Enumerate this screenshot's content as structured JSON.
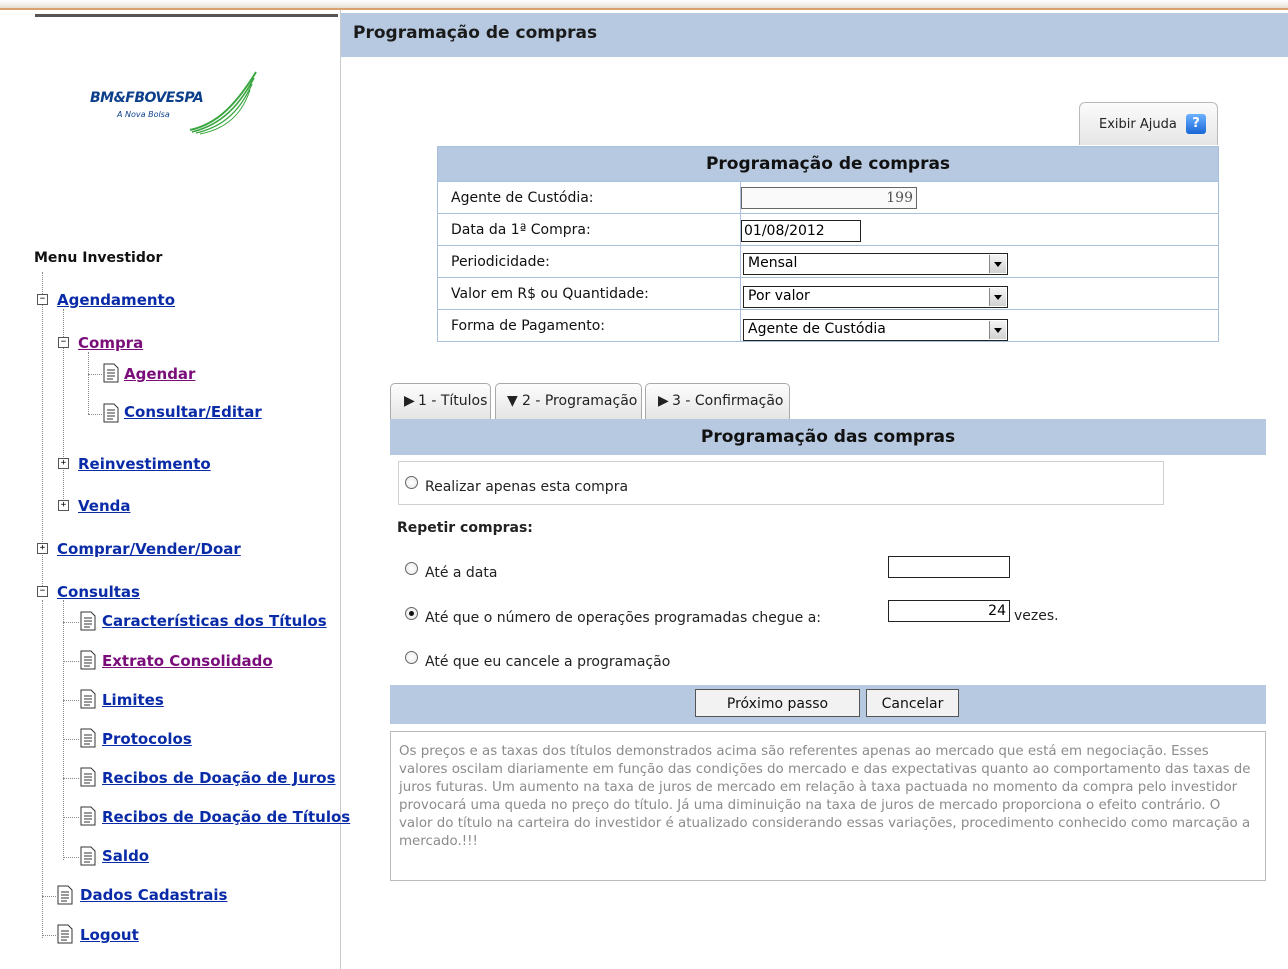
{
  "page": {
    "title": "Programação de compras"
  },
  "logo": {
    "name": "BM&FBOVESPA",
    "tagline": "A Nova Bolsa"
  },
  "sidebar": {
    "menu_title": "Menu Investidor",
    "items": {
      "agendamento": "Agendamento",
      "compra": "Compra",
      "agendar": "Agendar",
      "consultar_editar": "Consultar/Editar",
      "reinvestimento": "Reinvestimento",
      "venda": "Venda",
      "comprar_vender_doar": "Comprar/Vender/Doar",
      "consultas": "Consultas",
      "caracteristicas": "Características dos Títulos",
      "extrato": "Extrato Consolidado",
      "limites": "Limites",
      "protocolos": "Protocolos",
      "recibos_juros": "Recibos de Doação de Juros",
      "recibos_titulos": "Recibos de Doação de Títulos",
      "saldo": "Saldo",
      "dados_cadastrais": "Dados Cadastrais",
      "logout": "Logout"
    },
    "expand": {
      "minus": "−",
      "plus": "+"
    }
  },
  "help": {
    "label": "Exibir Ajuda",
    "icon": "?"
  },
  "form": {
    "title": "Programação de compras",
    "agente_label": "Agente de Custódia:",
    "agente_value": "199",
    "data_label": "Data da 1ª Compra:",
    "data_value": "01/08/2012",
    "periodicidade_label": "Periodicidade:",
    "periodicidade_value": "Mensal",
    "valor_label": "Valor em R$ ou Quantidade:",
    "valor_value": "Por valor",
    "pagamento_label": "Forma de Pagamento:",
    "pagamento_value": "Agente de Custódia"
  },
  "tabs": [
    {
      "label": "1 - Títulos",
      "arrow": "▶"
    },
    {
      "label": "2 - Programação",
      "arrow": "▼"
    },
    {
      "label": "3 - Confirmação",
      "arrow": "▶"
    }
  ],
  "programacao": {
    "title": "Programação das compras",
    "only_this": "Realizar apenas esta compra",
    "repeat_label": "Repetir compras:",
    "until_date": "Até a data",
    "until_date_value": "",
    "until_count": "Até que o número de operações programadas chegue a:",
    "count_value": "24",
    "count_unit": "vezes.",
    "until_cancel": "Até que eu cancele a programação",
    "selected_option": "until_count",
    "next_button": "Próximo passo",
    "cancel_button": "Cancelar"
  },
  "disclaimer": "Os preços e as taxas dos títulos demonstrados acima são referentes apenas ao mercado que está em negociação. Esses valores oscilam diariamente em função das condições do mercado e das expectativas quanto ao comportamento das taxas de juros futuras. Um aumento na taxa de juros de mercado em relação à taxa pactuada no momento da compra pelo investidor provocará uma queda no preço do título. Já uma diminuição na taxa de juros de mercado proporciona o efeito contrário. O valor do título na carteira do investidor é atualizado considerando essas variações, procedimento conhecido como marcação a mercado.!!!",
  "colors": {
    "header_blue": "#b7c9e0",
    "link_blue": "#0a2ba8",
    "link_visited": "#7a0d7a"
  }
}
